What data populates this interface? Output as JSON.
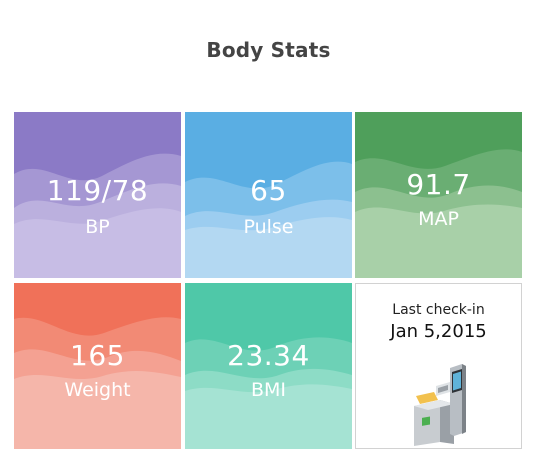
{
  "page": {
    "title": "Body Stats"
  },
  "tiles": [
    {
      "id": "bp",
      "value": "119/78",
      "label": "BP",
      "color": "#8a79c4"
    },
    {
      "id": "pulse",
      "value": "65",
      "label": "Pulse",
      "color": "#5aaee3"
    },
    {
      "id": "map",
      "value": "91.7",
      "label": "MAP",
      "color": "#4f9f5b"
    },
    {
      "id": "weight",
      "value": "165",
      "label": "Weight",
      "color": "#f07159"
    },
    {
      "id": "bmi",
      "value": "23.34",
      "label": "BMI",
      "color": "#4fc8a8"
    }
  ],
  "checkin": {
    "label": "Last check-in",
    "date": "Jan 5,2015",
    "icon": "kiosk-icon"
  }
}
